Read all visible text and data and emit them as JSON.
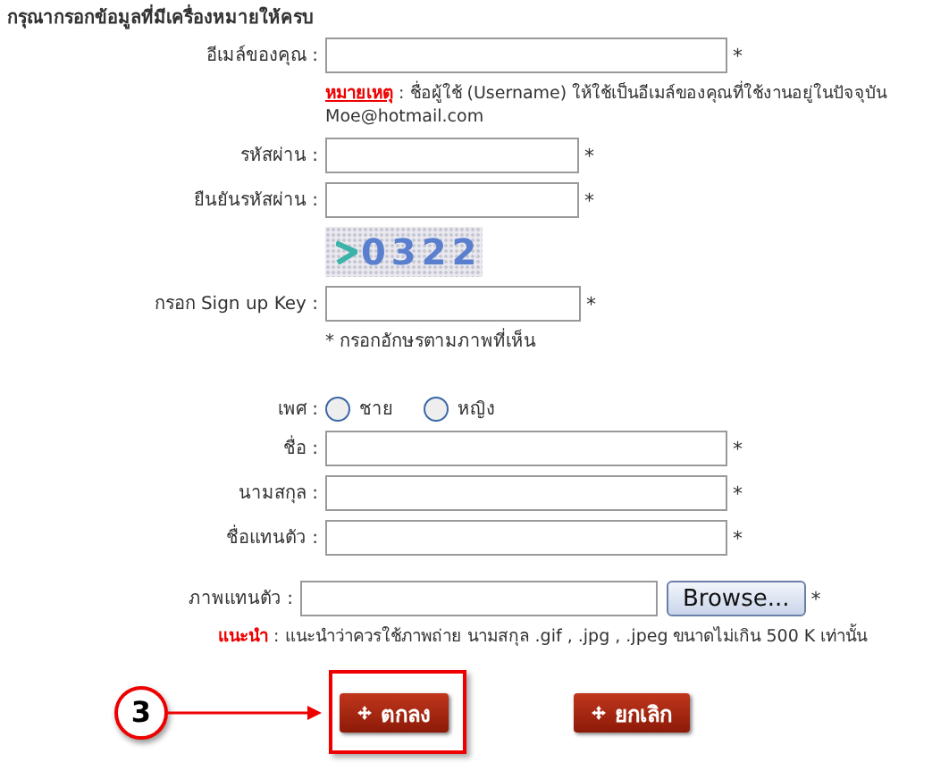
{
  "heading": "กรุณากรอกข้อมูลที่มีเครื่องหมายให้ครบ",
  "account_rows": [
    {
      "kind": "email",
      "label": "อีเมล์ของคุณ :",
      "required_mark": "*",
      "note_label": "หมายเหตุ",
      "note_text": ": ชื่อผู้ใช้ (Username) ให้ใช้เป็นอีเมล์ของคุณที่ใช้งานอยู่ในปัจจุบัน",
      "note_example": "Moe@hotmail.com"
    },
    {
      "kind": "password",
      "label": "รหัสผ่าน :",
      "required_mark": "*"
    },
    {
      "kind": "password",
      "label": "ยืนยันรหัสผ่าน :",
      "required_mark": "*"
    },
    {
      "kind": "captcha",
      "captcha_text": "0322"
    },
    {
      "kind": "signup_key",
      "label": "กรอก Sign up Key :",
      "required_mark": "*",
      "hint": "* กรอกอักษรตามภาพที่เห็น"
    }
  ],
  "profile_rows": [
    {
      "kind": "gender",
      "label": "เพศ :",
      "options": [
        {
          "label": "ชาย",
          "selected": false
        },
        {
          "label": "หญิง",
          "selected": false
        }
      ]
    },
    {
      "kind": "text",
      "label": "ชื่อ :",
      "required_mark": "*"
    },
    {
      "kind": "text",
      "label": "นามสกุล :",
      "required_mark": "*"
    },
    {
      "kind": "text",
      "label": "ชื่อแทนตัว :",
      "required_mark": "*"
    }
  ],
  "photo": {
    "label": "ภาพแทนตัว :",
    "browse": "Browse...",
    "required_mark": "*",
    "advice_label": "แนะนำ",
    "advice_text": ": แนะนำว่าควรใช้ภาพถ่าย นามสกุล .gif , .jpg , .jpeg ขนาดไม่เกิน 500 K เท่านั้น"
  },
  "callout": {
    "number": "3"
  },
  "buttons": [
    {
      "label": "ตกลง",
      "highlighted": true
    },
    {
      "label": "ยกเลิก",
      "highlighted": false
    }
  ]
}
